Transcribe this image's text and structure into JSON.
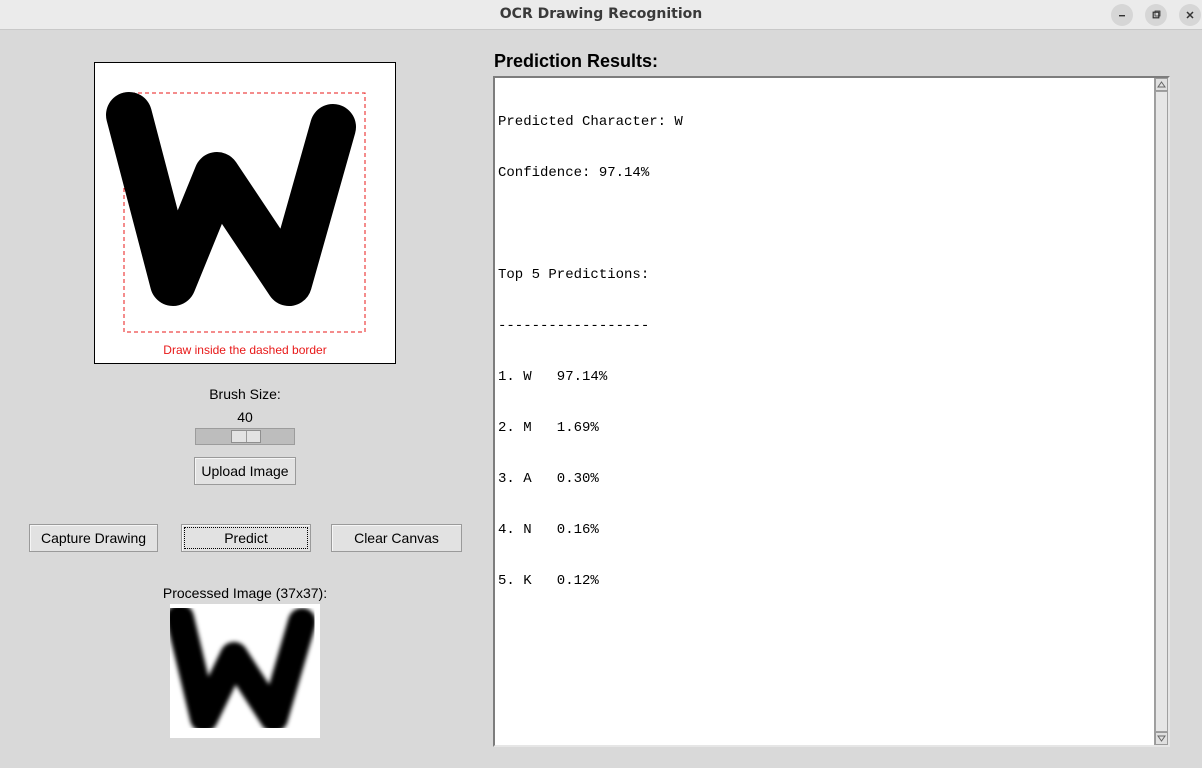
{
  "window": {
    "title": "OCR Drawing Recognition",
    "controls": [
      "minimize-icon",
      "maximize-icon",
      "close-icon"
    ]
  },
  "canvas": {
    "hint": "Draw inside the dashed border",
    "hint_color": "#e81818",
    "drawn_character": "W"
  },
  "brush": {
    "label": "Brush Size:",
    "value": "40",
    "slider_fraction": 0.4
  },
  "buttons": {
    "upload": "Upload Image",
    "capture": "Capture Drawing",
    "predict": "Predict",
    "clear": "Clear Canvas"
  },
  "processed": {
    "label": "Processed Image (37x37):"
  },
  "results": {
    "title": "Prediction Results:",
    "predicted_line": "Predicted Character: W",
    "confidence_line": "Confidence: 97.14%",
    "top_header": "Top 5 Predictions:",
    "separator": "------------------",
    "predictions": [
      "1. W   97.14%",
      "2. M   1.69%",
      "3. A   0.30%",
      "4. N   0.16%",
      "5. K   0.12%"
    ]
  }
}
